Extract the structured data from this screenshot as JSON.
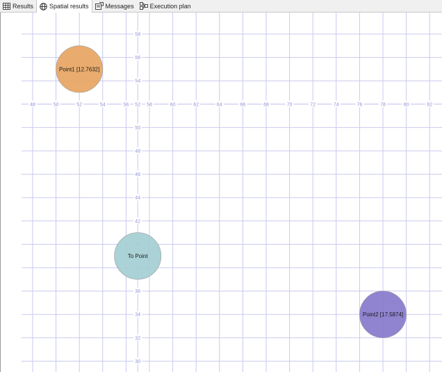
{
  "tabs": [
    {
      "label": "Results",
      "icon": "grid-icon",
      "active": false
    },
    {
      "label": "Spatial results",
      "icon": "globe-icon",
      "active": true
    },
    {
      "label": "Messages",
      "icon": "messages-icon",
      "active": false
    },
    {
      "label": "Execution plan",
      "icon": "execution-plan-icon",
      "active": false
    }
  ],
  "chart_data": {
    "type": "scatter",
    "x_ticks": [
      48,
      50,
      52,
      54,
      56,
      58,
      60,
      62,
      64,
      66,
      68,
      70,
      72,
      74,
      76,
      78,
      80,
      82
    ],
    "y_ticks": [
      58,
      56,
      54,
      52,
      50,
      48,
      46,
      44,
      42,
      40,
      38,
      36,
      34,
      32,
      30
    ],
    "colors": {
      "grid": "#c9c9f0",
      "tick": "#8f8fd6"
    },
    "points": [
      {
        "label": "Point1 [12.7632]",
        "x": 52,
        "y": 55,
        "r": 2,
        "color": "#e8a866"
      },
      {
        "label": "To Point",
        "x": 57,
        "y": 39,
        "r": 2,
        "color": "#a6d0d4"
      },
      {
        "label": "Point2 [17.5874]",
        "x": 78,
        "y": 34,
        "r": 2,
        "color": "#8a7dcd"
      }
    ]
  }
}
